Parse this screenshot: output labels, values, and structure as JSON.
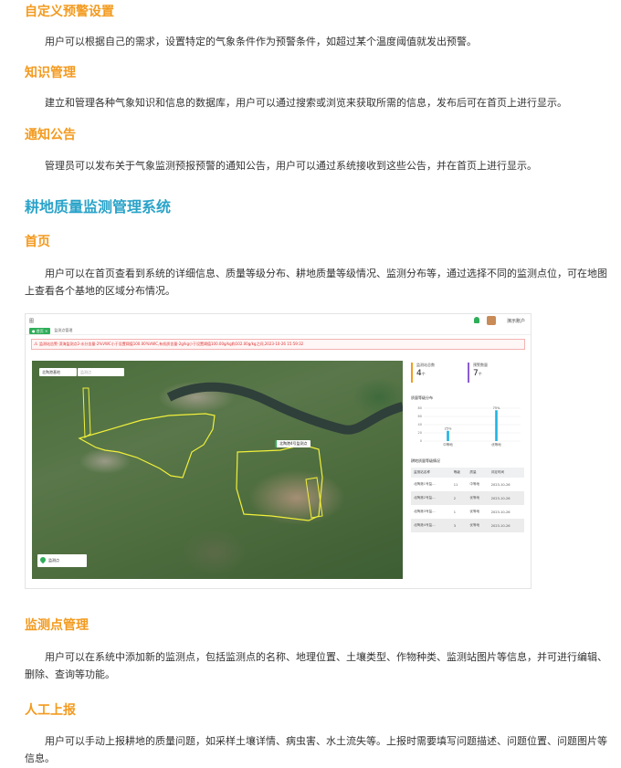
{
  "sections": {
    "custom_alert": {
      "title": "自定义预警设置",
      "text": "用户可以根据自己的需求，设置特定的气象条件作为预警条件，如超过某个温度阈值就发出预警。"
    },
    "knowledge": {
      "title": "知识管理",
      "text": "建立和管理各种气象知识和信息的数据库，用户可以通过搜索或浏览来获取所需的信息，发布后可在首页上进行显示。"
    },
    "notice": {
      "title": "通知公告",
      "text": "管理员可以发布关于气象监测预报预警的通知公告，用户可以通过系统接收到这些公告，并在首页上进行显示。"
    },
    "system_title": "耕地质量监测管理系统",
    "home": {
      "title": "首页",
      "text": "用户可以在首页查看到系统的详细信息、质量等级分布、耕地质量等级情况、监测分布等，通过选择不同的监测点位，可在地图上查看各个基地的区域分布情况。"
    },
    "monitor_point": {
      "title": "监测点管理",
      "text": "用户可以在系统中添加新的监测点，包括监测点的名称、地理位置、土壤类型、作物种类、监测站图片等信息，并可进行编辑、删除、查询等功能。"
    },
    "manual_report": {
      "title": "人工上报",
      "text": "用户可以手动上报耕地的质量问题，如采样土壤详情、病虫害、水土流失等。上报时需要填写问题描述、问题位置、问题图片等信息。"
    }
  },
  "screenshot": {
    "logo": "图",
    "user_name": "演示账户",
    "tabs": [
      "● 首页 ×",
      "监测点管理"
    ],
    "alert_text": "监测站告警-滨海监测点2-水分含量-2%VWC小于设置阈值100.00%VWC,有机质含量-2g/kg小于设置阈值100.00g/kg和102.00g/kg之间,2023-10-26 15:59:32",
    "map": {
      "select_label": "北陶港基地",
      "search_placeholder": "监测点",
      "tooltip": "北陶港4号监测点",
      "legend_label": "监测点"
    },
    "stats": [
      {
        "label": "监测站总数",
        "value": "4",
        "unit": "个",
        "color": "#f29c1f"
      },
      {
        "label": "预警数量",
        "value": "7",
        "unit": "个",
        "color": "#8b5bd3"
      }
    ],
    "chart_section_title": "质量等级分布",
    "levels_section_title": "耕地质量等级情况",
    "table": {
      "headers": [
        "监测站名称",
        "等级",
        "质量",
        "评定时间"
      ],
      "rows": [
        [
          "北陶港1号监...",
          "11",
          "中等地",
          "2023-10-26"
        ],
        [
          "北陶港2号监...",
          "2",
          "优等地",
          "2023-10-26"
        ],
        [
          "北陶港3号监...",
          "1",
          "优等地",
          "2023-10-26"
        ],
        [
          "北陶港4号监...",
          "3",
          "优等地",
          "2023-10-26"
        ]
      ]
    }
  },
  "chart_data": {
    "type": "bar",
    "categories": [
      "中等地",
      "优等地"
    ],
    "values": [
      25,
      75
    ],
    "data_labels": [
      "25%",
      "75%"
    ],
    "ylim": [
      0,
      80
    ],
    "yticks": [
      0,
      20,
      40,
      60,
      80
    ],
    "bar_color": "#1fb4e0",
    "grid": true
  }
}
